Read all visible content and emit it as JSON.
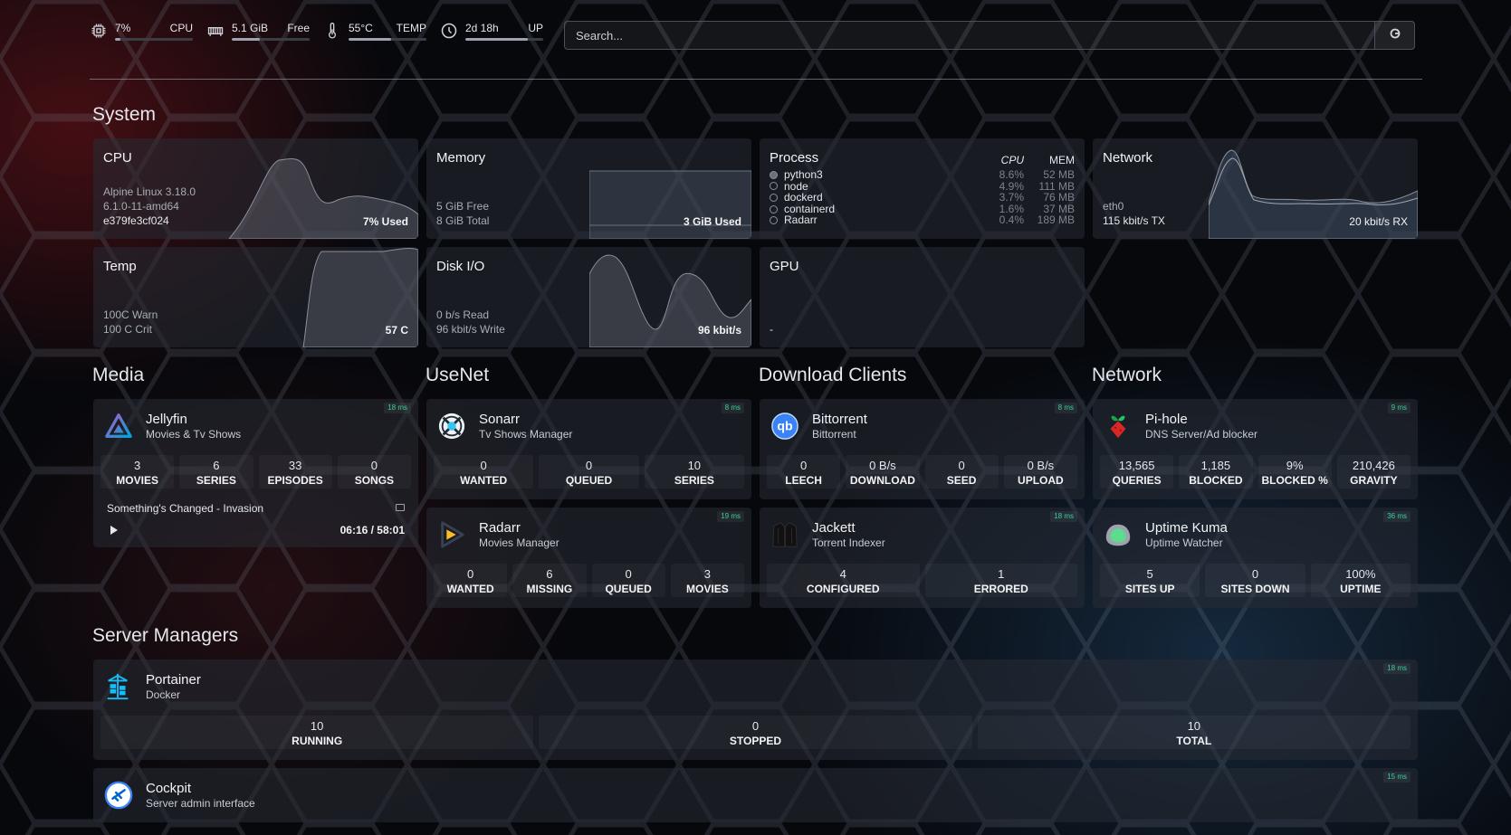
{
  "topbar": {
    "resources": [
      {
        "icon": "cpu-chip-icon",
        "value": "7%",
        "label": "CPU",
        "level": 0.07
      },
      {
        "icon": "memory-icon",
        "value": "5.1 GiB",
        "label": "Free",
        "level": 0.36
      },
      {
        "icon": "thermometer-icon",
        "value": "55°C",
        "label": "TEMP",
        "level": 0.55
      },
      {
        "icon": "clock-icon",
        "value": "2d 18h",
        "label": "UP",
        "level": 0.8
      }
    ],
    "search_placeholder": "Search..."
  },
  "sections": {
    "system": "System",
    "media": "Media",
    "usenet": "UseNet",
    "download": "Download Clients",
    "network": "Network",
    "server_managers": "Server Managers"
  },
  "system": {
    "cpu": {
      "title": "CPU",
      "lines": [
        "Alpine Linux 3.18.0",
        "6.1.0-11-amd64",
        "e379fe3cf024"
      ],
      "used": "7% Used"
    },
    "memory": {
      "title": "Memory",
      "lines": [
        "5 GiB Free",
        "8 GiB Total"
      ],
      "used": "3 GiB Used"
    },
    "process": {
      "title": "Process",
      "col_cpu": "CPU",
      "col_mem": "MEM",
      "rows": [
        {
          "name": "python3",
          "cpu": "8.6%",
          "mem": "52 MB"
        },
        {
          "name": "node",
          "cpu": "4.9%",
          "mem": "111 MB"
        },
        {
          "name": "dockerd",
          "cpu": "3.7%",
          "mem": "76 MB"
        },
        {
          "name": "containerd",
          "cpu": "1.6%",
          "mem": "37 MB"
        },
        {
          "name": "Radarr",
          "cpu": "0.4%",
          "mem": "189 MB"
        }
      ]
    },
    "network": {
      "title": "Network",
      "lines": [
        "eth0",
        "115 kbit/s TX"
      ],
      "rx": "20 kbit/s RX"
    },
    "temp": {
      "title": "Temp",
      "lines": [
        "100C Warn",
        "100 C Crit"
      ],
      "value": "57 C"
    },
    "disk": {
      "title": "Disk I/O",
      "lines": [
        "0 b/s Read",
        "96 kbit/s Write"
      ],
      "value": "96 kbit/s"
    },
    "gpu": {
      "title": "GPU",
      "value": "-"
    }
  },
  "services": {
    "jellyfin": {
      "name": "Jellyfin",
      "desc": "Movies & Tv Shows",
      "ping": "18 ms",
      "stats": [
        {
          "v": "3",
          "l": "MOVIES"
        },
        {
          "v": "6",
          "l": "SERIES"
        },
        {
          "v": "33",
          "l": "EPISODES"
        },
        {
          "v": "0",
          "l": "SONGS"
        }
      ],
      "now_playing": "Something's Changed - Invasion",
      "time": "06:16 / 58:01"
    },
    "sonarr": {
      "name": "Sonarr",
      "desc": "Tv Shows Manager",
      "ping": "8 ms",
      "stats": [
        {
          "v": "0",
          "l": "WANTED"
        },
        {
          "v": "0",
          "l": "QUEUED"
        },
        {
          "v": "10",
          "l": "SERIES"
        }
      ]
    },
    "radarr": {
      "name": "Radarr",
      "desc": "Movies Manager",
      "ping": "19 ms",
      "stats": [
        {
          "v": "0",
          "l": "WANTED"
        },
        {
          "v": "6",
          "l": "MISSING"
        },
        {
          "v": "0",
          "l": "QUEUED"
        },
        {
          "v": "3",
          "l": "MOVIES"
        }
      ]
    },
    "bittorrent": {
      "name": "Bittorrent",
      "desc": "Bittorrent",
      "ping": "8 ms",
      "stats": [
        {
          "v": "0",
          "l": "LEECH"
        },
        {
          "v": "0 B/s",
          "l": "DOWNLOAD"
        },
        {
          "v": "0",
          "l": "SEED"
        },
        {
          "v": "0 B/s",
          "l": "UPLOAD"
        }
      ]
    },
    "jackett": {
      "name": "Jackett",
      "desc": "Torrent Indexer",
      "ping": "18 ms",
      "stats": [
        {
          "v": "4",
          "l": "CONFIGURED"
        },
        {
          "v": "1",
          "l": "ERRORED"
        }
      ]
    },
    "pihole": {
      "name": "Pi-hole",
      "desc": "DNS Server/Ad blocker",
      "ping": "9 ms",
      "stats": [
        {
          "v": "13,565",
          "l": "QUERIES"
        },
        {
          "v": "1,185",
          "l": "BLOCKED"
        },
        {
          "v": "9%",
          "l": "BLOCKED %"
        },
        {
          "v": "210,426",
          "l": "GRAVITY"
        }
      ]
    },
    "uptime": {
      "name": "Uptime Kuma",
      "desc": "Uptime Watcher",
      "ping": "36 ms",
      "stats": [
        {
          "v": "5",
          "l": "SITES UP"
        },
        {
          "v": "0",
          "l": "SITES DOWN"
        },
        {
          "v": "100%",
          "l": "UPTIME"
        }
      ]
    },
    "portainer": {
      "name": "Portainer",
      "desc": "Docker",
      "ping": "18 ms",
      "stats": [
        {
          "v": "10",
          "l": "RUNNING"
        },
        {
          "v": "0",
          "l": "STOPPED"
        },
        {
          "v": "10",
          "l": "TOTAL"
        }
      ]
    },
    "cockpit": {
      "name": "Cockpit",
      "desc": "Server admin interface",
      "ping": "15 ms"
    }
  }
}
